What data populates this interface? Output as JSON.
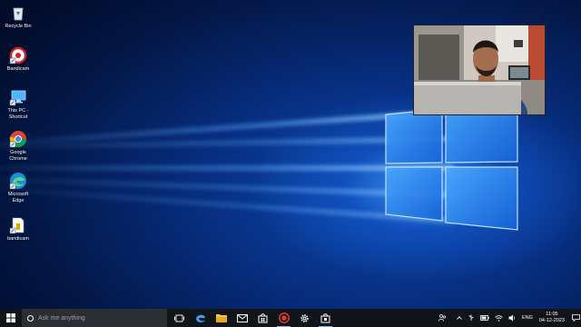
{
  "desktop_icons": [
    {
      "label": "Recycle Bin",
      "icon": "recycle-bin-icon"
    },
    {
      "label": "Bandicam",
      "icon": "bandicam-icon"
    },
    {
      "label": "This PC - Shortcut",
      "icon": "this-pc-icon"
    },
    {
      "label": "Google Chrome",
      "icon": "chrome-icon"
    },
    {
      "label": "Microsoft Edge",
      "icon": "edge-icon"
    },
    {
      "label": "bandicam",
      "icon": "bandicam-folder-icon"
    }
  ],
  "taskbar": {
    "search_placeholder": "Ask me anything",
    "pinned_apps": [
      "task-view-icon",
      "edge-icon",
      "file-explorer-icon",
      "mail-icon",
      "store-icon",
      "bandicam-record-icon",
      "settings-icon",
      "store-bag-icon"
    ],
    "tray": {
      "language": "ENG",
      "time": "11:05",
      "date": "04-12-2023"
    }
  },
  "colors": {
    "taskbar": "#111418",
    "search_box": "#2b2e33",
    "accent": "#0a78d7"
  }
}
